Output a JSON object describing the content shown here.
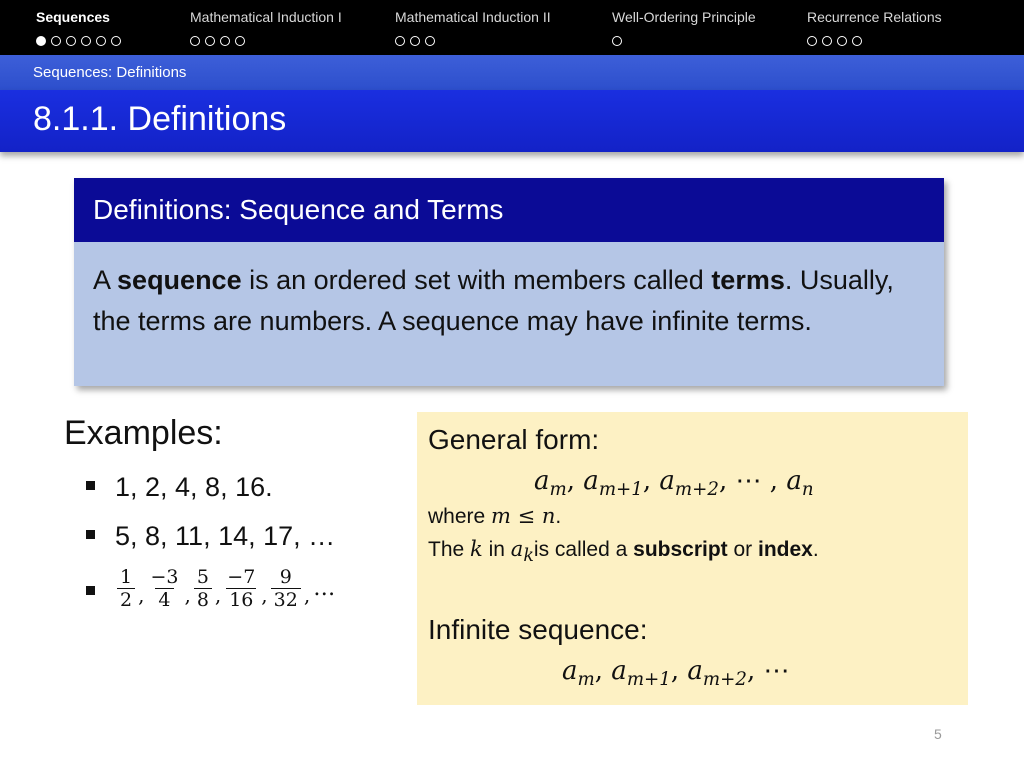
{
  "nav": {
    "sections": [
      {
        "title": "Sequences",
        "dots": 6,
        "filled_index": 0,
        "active": true
      },
      {
        "title": "Mathematical Induction I",
        "dots": 4,
        "filled_index": -1,
        "active": false
      },
      {
        "title": "Mathematical Induction II",
        "dots": 3,
        "filled_index": -1,
        "active": false
      },
      {
        "title": "Well-Ordering Principle",
        "dots": 1,
        "filled_index": -1,
        "active": false
      },
      {
        "title": "Recurrence Relations",
        "dots": 4,
        "filled_index": -1,
        "active": false
      }
    ]
  },
  "subsection": "Sequences: Definitions",
  "slide_title": "8.1.1. Definitions",
  "definition": {
    "title": "Definitions: Sequence and Terms",
    "text_a": "A ",
    "term_sequence": "sequence",
    "text_b": " is an ordered set with members called ",
    "term_terms": "terms",
    "text_c": ". Usually, the terms are numbers. A sequence may have infinite terms."
  },
  "examples": {
    "title": "Examples:",
    "item1": "1, 2, 4, 8, 16.",
    "item2": "5, 8, 11, 14, 17, …",
    "item3": {
      "fractions": [
        {
          "num": "1",
          "den": "2"
        },
        {
          "num": "−3",
          "den": "4"
        },
        {
          "num": "5",
          "den": "8"
        },
        {
          "num": "−7",
          "den": "16"
        },
        {
          "num": "9",
          "den": "32"
        }
      ],
      "separator": ",",
      "ellipsis": "…"
    }
  },
  "general_form": {
    "title": "General form:",
    "formula": {
      "a": "a",
      "sub1": "m",
      "sub2": "m+1",
      "sub3": "m+2",
      "sub_last": "n",
      "sep": ", ",
      "dots": "⋯",
      "sep_dots": " , "
    },
    "where_text": "where ",
    "where_math": "m ≤ n",
    "where_end": ".",
    "index_the": "The ",
    "index_k": "k",
    "index_in": " in ",
    "index_a": "a",
    "index_sub": "k",
    "index_called": "is called a ",
    "index_subscript": "subscript",
    "index_or": " or ",
    "index_index": "index",
    "index_end": ".",
    "infinite_title": "Infinite sequence:",
    "infinite_formula": {
      "a": "a",
      "sub1": "m",
      "sub2": "m+1",
      "sub3": "m+2",
      "sep": ", ",
      "dots": "⋯"
    }
  },
  "page_number": "5",
  "colors": {
    "navbar": "#000000",
    "subbar": "#3d5fd9",
    "titlebar": "#1a2fe0",
    "block_header": "#0b0b96",
    "block_body": "#b5c6e6",
    "general_form_bg": "#fdf1c4"
  }
}
